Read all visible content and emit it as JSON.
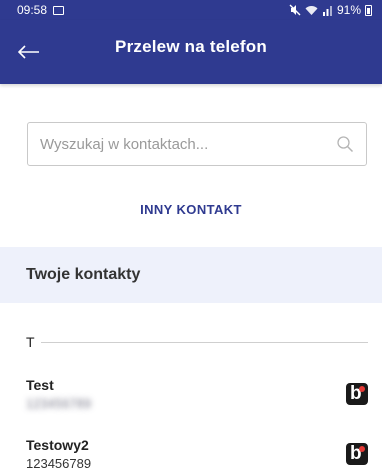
{
  "status_bar": {
    "time": "09:58",
    "battery": "91%",
    "icons": [
      "image-icon",
      "mute-icon",
      "wifi-icon",
      "signal-icon",
      "battery-icon"
    ]
  },
  "app_bar": {
    "title": "Przelew na telefon",
    "back_icon": "arrow-left-icon",
    "background": "#2f3a90"
  },
  "search": {
    "placeholder": "Wyszukaj w kontaktach...",
    "value": "",
    "icon": "search-icon"
  },
  "other_contact_label": "INNY KONTAKT",
  "contacts_section": {
    "title": "Twoje kontakty",
    "groups": [
      {
        "letter": "T",
        "contacts": [
          {
            "name": "Test",
            "phone": "123456789",
            "phone_obscured": true,
            "badge": "blik-icon"
          },
          {
            "name": "Testowy2",
            "phone": "123456789",
            "phone_obscured": false,
            "badge": "blik-icon"
          }
        ]
      }
    ]
  },
  "colors": {
    "primary": "#2f3a90",
    "section_background": "#eef1fb",
    "blik_badge": "#1a1a1a",
    "blik_dot": "#e53935"
  }
}
